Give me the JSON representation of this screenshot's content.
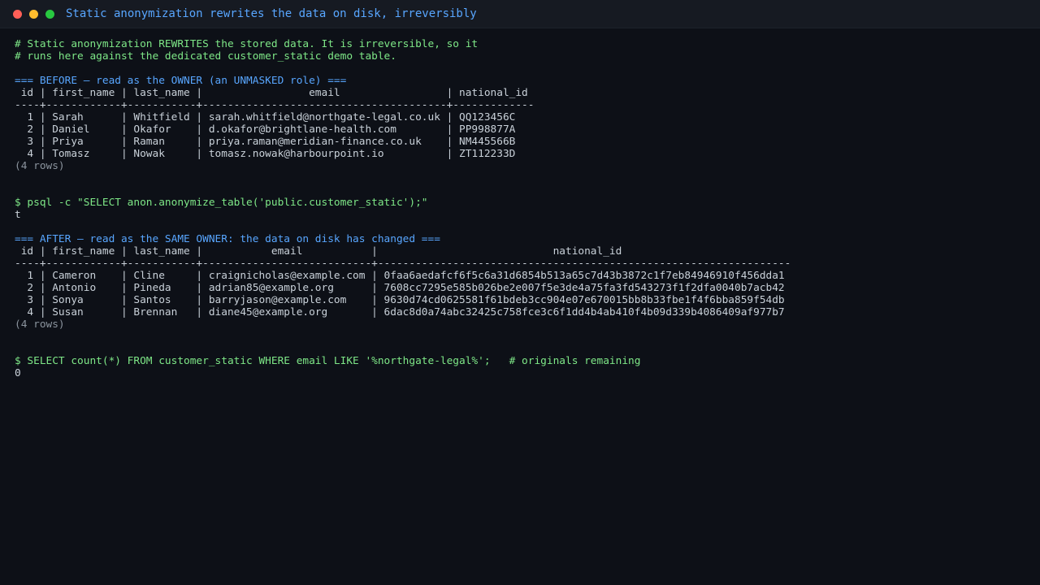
{
  "window": {
    "title": "Static anonymization rewrites the data on disk, irreversibly"
  },
  "colors": {
    "background": "#0d1017",
    "titlebar": "#161a22",
    "comment": "#7ee787",
    "header": "#58a6ff",
    "output": "#c9d1d9",
    "dim": "#8b949e"
  },
  "terminal": {
    "lines": [
      {
        "kind": "comment",
        "text": "# Static anonymization REWRITES the stored data. It is irreversible, so it"
      },
      {
        "kind": "comment",
        "text": "# runs here against the dedicated customer_static demo table."
      },
      {
        "kind": "blank",
        "text": ""
      },
      {
        "kind": "header",
        "text": "=== BEFORE — read as the OWNER (an UNMASKED role) ==="
      },
      {
        "kind": "out",
        "text": " id | first_name | last_name |                 email                 | national_id"
      },
      {
        "kind": "out",
        "text": "----+------------+-----------+---------------------------------------+-------------"
      },
      {
        "kind": "out",
        "text": "  1 | Sarah      | Whitfield | sarah.whitfield@northgate-legal.co.uk | QQ123456C"
      },
      {
        "kind": "out",
        "text": "  2 | Daniel     | Okafor    | d.okafor@brightlane-health.com        | PP998877A"
      },
      {
        "kind": "out",
        "text": "  3 | Priya      | Raman     | priya.raman@meridian-finance.co.uk    | NM445566B"
      },
      {
        "kind": "out",
        "text": "  4 | Tomasz     | Nowak     | tomasz.nowak@harbourpoint.io          | ZT112233D"
      },
      {
        "kind": "dim",
        "text": "(4 rows)"
      },
      {
        "kind": "blank",
        "text": ""
      },
      {
        "kind": "blank",
        "text": ""
      },
      {
        "kind": "command",
        "text": "$ psql -c \"SELECT anon.anonymize_table('public.customer_static');\""
      },
      {
        "kind": "out",
        "text": "t"
      },
      {
        "kind": "blank",
        "text": ""
      },
      {
        "kind": "header",
        "text": "=== AFTER — read as the SAME OWNER: the data on disk has changed ==="
      },
      {
        "kind": "out",
        "text": " id | first_name | last_name |           email           |                            national_id"
      },
      {
        "kind": "out",
        "text": "----+------------+-----------+---------------------------+------------------------------------------------------------------"
      },
      {
        "kind": "out",
        "text": "  1 | Cameron    | Cline     | craignicholas@example.com | 0faa6aedafcf6f5c6a31d6854b513a65c7d43b3872c1f7eb84946910f456dda1"
      },
      {
        "kind": "out",
        "text": "  2 | Antonio    | Pineda    | adrian85@example.org      | 7608cc7295e585b026be2e007f5e3de4a75fa3fd543273f1f2dfa0040b7acb42"
      },
      {
        "kind": "out",
        "text": "  3 | Sonya      | Santos    | barryjason@example.com    | 9630d74cd0625581f61bdeb3cc904e07e670015bb8b33fbe1f4f6bba859f54db"
      },
      {
        "kind": "out",
        "text": "  4 | Susan      | Brennan   | diane45@example.org       | 6dac8d0a74abc32425c758fce3c6f1dd4b4ab410f4b09d339b4086409af977b7"
      },
      {
        "kind": "dim",
        "text": "(4 rows)"
      },
      {
        "kind": "blank",
        "text": ""
      },
      {
        "kind": "blank",
        "text": ""
      },
      {
        "kind": "command",
        "text": "$ SELECT count(*) FROM customer_static WHERE email LIKE '%northgate-legal%';   # originals remaining"
      },
      {
        "kind": "out",
        "text": "0"
      }
    ]
  }
}
